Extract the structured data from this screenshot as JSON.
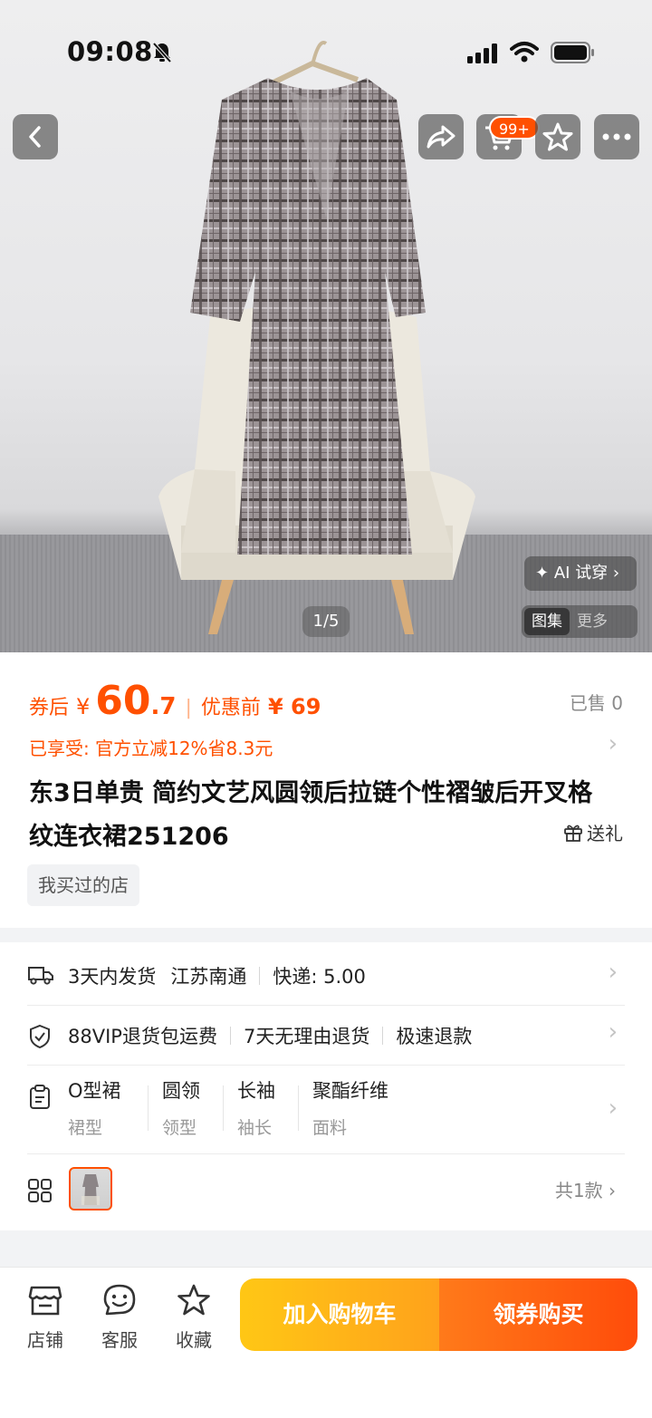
{
  "status_bar": {
    "time": "09:08"
  },
  "nav": {
    "cart_badge": "99+"
  },
  "gallery": {
    "ai_tryon": "AI 试穿",
    "pager": "1/5",
    "tab_gallery": "图集",
    "tab_more": "更多"
  },
  "price": {
    "after_coupon_label": "券后",
    "currency": "¥",
    "after_coupon_int": "60",
    "after_coupon_dec": ".7",
    "before_label": "优惠前",
    "before_value": "¥ 69",
    "sold": "已售 0",
    "enjoy": "已享受: 官方立减12%省8.3元"
  },
  "product": {
    "title": "东3日单贵 简约文艺风圆领后拉链个性褶皱后开叉格纹连衣裙251206",
    "gift": "送礼",
    "shop_tag": "我买过的店"
  },
  "shipping": {
    "days": "3天内发货",
    "origin": "江苏南通",
    "express": "快递: 5.00"
  },
  "service": {
    "vip": "88VIP退货包运费",
    "return": "7天无理由退货",
    "refund": "极速退款"
  },
  "attributes": [
    {
      "value": "O型裙",
      "key": "裙型"
    },
    {
      "value": "圆领",
      "key": "领型"
    },
    {
      "value": "长袖",
      "key": "袖长"
    },
    {
      "value": "聚酯纤维",
      "key": "面料"
    }
  ],
  "variants": {
    "count": "共1款"
  },
  "bottom_bar": {
    "shop": "店铺",
    "service": "客服",
    "favorite": "收藏",
    "add_cart": "加入购物车",
    "buy": "领券购买"
  },
  "colors": {
    "accent": "#ff5000",
    "cart_btn": "#ffb31a",
    "buy_btn": "#ff5a10"
  }
}
